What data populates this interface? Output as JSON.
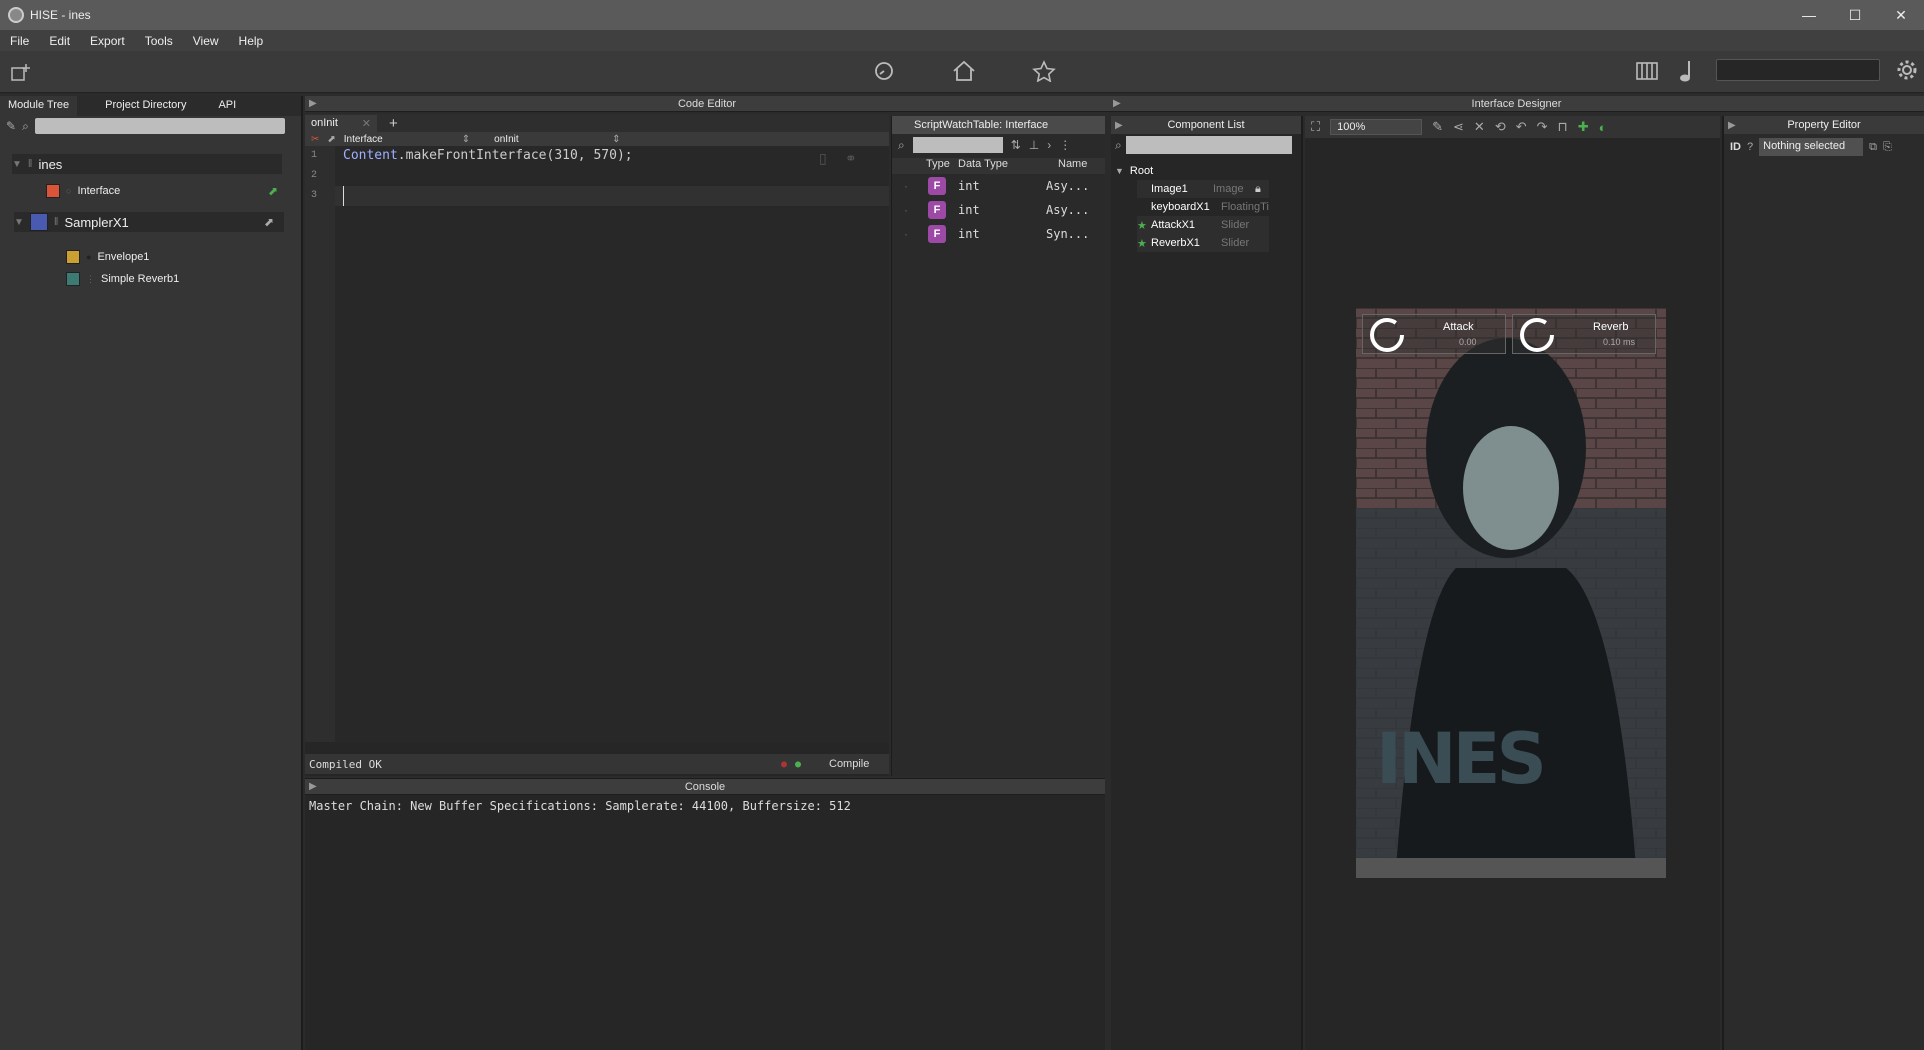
{
  "window": {
    "title": "HISE - ines",
    "controls": [
      "—",
      "☐",
      "✕"
    ]
  },
  "menu": [
    "File",
    "Edit",
    "Export",
    "Tools",
    "View",
    "Help"
  ],
  "left_panel": {
    "tabs": [
      "Module Tree",
      "Project Directory",
      "API"
    ],
    "tree": [
      {
        "label": "ines",
        "color": ""
      },
      {
        "label": "Interface",
        "color": "#d9553a"
      },
      {
        "label": "SamplerX1",
        "color": "#4a5ab0"
      },
      {
        "label": "Envelope1",
        "color": "#c9a031"
      },
      {
        "label": "Simple Reverb1",
        "color": "#3d7a74"
      }
    ]
  },
  "code_editor": {
    "header": "Code Editor",
    "tab": "onInit",
    "selector_left": "Interface",
    "selector_right": "onInit",
    "lines": [
      "1",
      "2",
      "3"
    ],
    "code_obj": "Content",
    "code_rest": ".makeFrontInterface(310, 570);",
    "status": "Compiled OK",
    "compile_label": "Compile"
  },
  "watch_table": {
    "title": "ScriptWatchTable: Interface",
    "columns": [
      "Type",
      "Data Type",
      "Name"
    ],
    "rows": [
      {
        "type": "F",
        "dtype": "int",
        "name": "Asy..."
      },
      {
        "type": "F",
        "dtype": "int",
        "name": "Asy..."
      },
      {
        "type": "F",
        "dtype": "int",
        "name": "Syn..."
      }
    ]
  },
  "console": {
    "header": "Console",
    "message": "Master Chain: New Buffer Specifications: Samplerate: 44100, Buffersize: 512"
  },
  "designer": {
    "header": "Interface Designer",
    "component_list_header": "Component List",
    "root_label": "Root",
    "components": [
      {
        "name": "Image1",
        "type": "Image"
      },
      {
        "name": "keyboardX1",
        "type": "FloatingTile"
      },
      {
        "name": "AttackX1",
        "type": "Slider"
      },
      {
        "name": "ReverbX1",
        "type": "Slider"
      }
    ],
    "zoom": "100%",
    "knobs": [
      {
        "label": "Attack",
        "value": "0.00"
      },
      {
        "label": "Reverb",
        "value": "0.10 ms"
      }
    ],
    "logo_text": "INES"
  },
  "property_editor": {
    "header": "Property Editor",
    "id_label": "ID",
    "selection": "Nothing selected"
  }
}
